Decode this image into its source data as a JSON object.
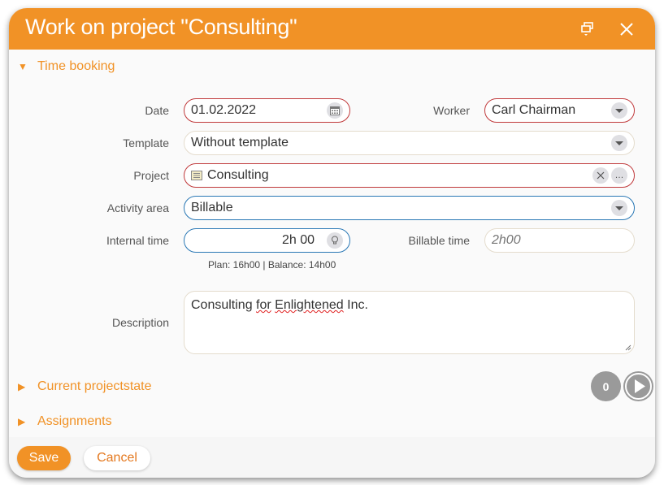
{
  "dialog": {
    "title": "Work on project \"Consulting\"",
    "restore_icon": "restore-window-icon",
    "close_icon": "close-icon"
  },
  "sections": {
    "time_booking": {
      "label": "Time booking",
      "expanded": true
    },
    "current_projectstate": {
      "label": "Current projectstate",
      "expanded": false
    },
    "assignments": {
      "label": "Assignments",
      "expanded": false
    }
  },
  "form": {
    "date": {
      "label": "Date",
      "value": "01.02.2022",
      "icon": "calendar-icon"
    },
    "worker": {
      "label": "Worker",
      "value": "Carl Chairman"
    },
    "template": {
      "label": "Template",
      "value": "Without template"
    },
    "project": {
      "label": "Project",
      "value": "Consulting",
      "icon": "project-icon"
    },
    "activity_area": {
      "label": "Activity area",
      "value": "Billable"
    },
    "internal_time": {
      "label": "Internal time",
      "value": "2h 00",
      "icon": "lightbulb-icon"
    },
    "billable_time": {
      "label": "Billable time",
      "placeholder": "2h00"
    },
    "plan_hint": "Plan: 16h00  |  Balance: 14h00",
    "description": {
      "label": "Description",
      "value_parts": [
        "Consulting ",
        "for",
        " ",
        "Enlightened",
        " Inc."
      ]
    }
  },
  "projectstate": {
    "count": "0"
  },
  "footer": {
    "save_label": "Save",
    "cancel_label": "Cancel"
  },
  "colors": {
    "accent": "#f19226",
    "required_border": "#c0393b",
    "focus_border": "#2a78b5"
  }
}
